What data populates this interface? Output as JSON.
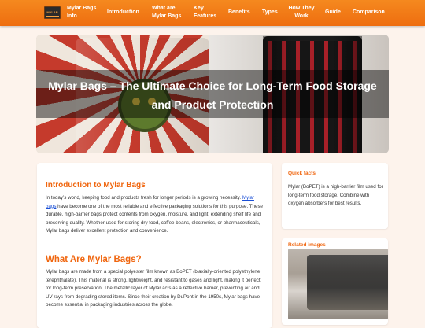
{
  "nav": {
    "logo_text": "MYLAR",
    "items": [
      "Mylar Bags Info",
      "Introduction",
      "What are Mylar Bags",
      "Key Features",
      "Benefits",
      "Types",
      "How They Work",
      "Guide",
      "Comparison"
    ]
  },
  "hero": {
    "title": "Mylar Bags – The Ultimate Choice for Long-Term Food Storage and Product Protection"
  },
  "article": {
    "intro_heading": "Introduction to Mylar Bags",
    "intro_p_before": "In today’s world, keeping food and products fresh for longer periods is a growing necessity. ",
    "intro_link": "Mylar bags",
    "intro_p_after": " have become one of the most reliable and effective packaging solutions for this purpose. These durable, high-barrier bags protect contents from oxygen, moisture, and light, extending shelf life and preserving quality. Whether used for storing dry food, coffee beans, electronics, or pharmaceuticals, Mylar bags deliver excellent protection and convenience.",
    "what_heading": "What Are Mylar Bags?",
    "what_p": "Mylar bags are made from a special polyester film known as BoPET (biaxially-oriented polyethylene terephthalate). This material is strong, lightweight, and resistant to gases and light, making it perfect for long-term preservation. The metallic layer of Mylar acts as a reflective barrier, preventing air and UV rays from degrading stored items. Since their creation by DuPont in the 1950s, Mylar bags have become essential in packaging industries across the globe."
  },
  "sidebar": {
    "quick_title": "Quick facts",
    "quick_text": "Mylar (BoPET) is a high-barrier film used for long-term food storage. Combine with oxygen absorbers for best results.",
    "related_title": "Related images"
  },
  "colors": {
    "accent": "#f0660f",
    "nav_top": "#f5891f",
    "nav_bottom": "#ee6d0f",
    "link": "#1a4fd6",
    "page_bg": "#fdf3ec"
  }
}
